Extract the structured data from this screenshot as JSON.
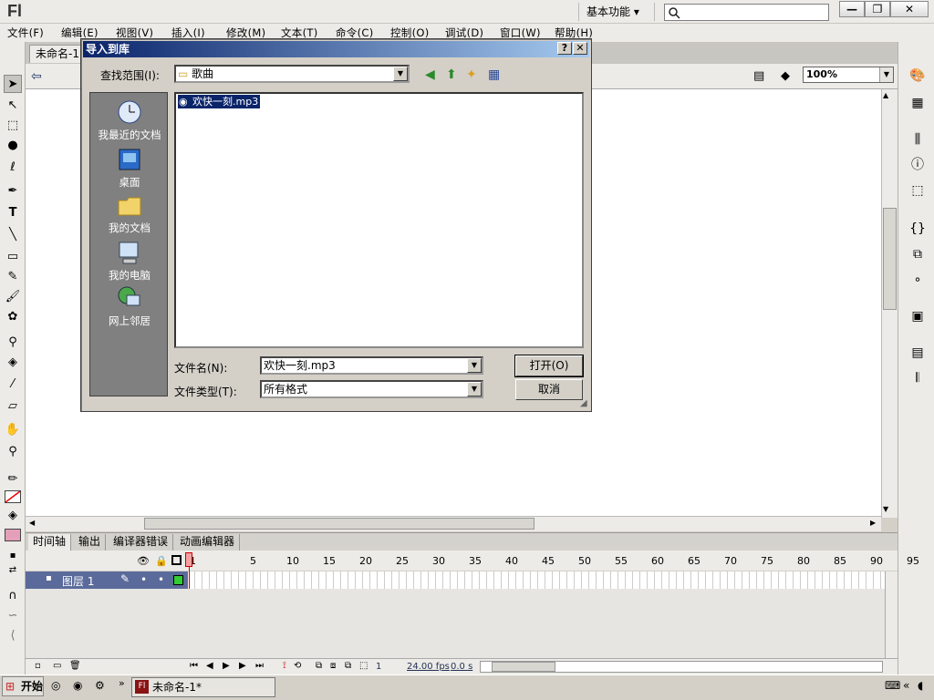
{
  "app": {
    "logo": "Fl",
    "workspace": "基本功能 ▾",
    "window_buttons": [
      "—",
      "❐",
      "✕"
    ]
  },
  "menu": [
    "文件(F)",
    "编辑(E)",
    "视图(V)",
    "插入(I)",
    "修改(M)",
    "文本(T)",
    "命令(C)",
    "控制(O)",
    "调试(D)",
    "窗口(W)",
    "帮助(H)"
  ],
  "document": {
    "tab": "未命名-1",
    "zoom": "100%"
  },
  "dialog": {
    "title": "导入到库",
    "look_in_label": "查找范围(I):",
    "look_in_value": "歌曲",
    "places": [
      "我最近的文档",
      "桌面",
      "我的文档",
      "我的电脑",
      "网上邻居"
    ],
    "files": [
      "欢快一刻.mp3"
    ],
    "filename_label": "文件名(N):",
    "filename_value": "欢快一刻.mp3",
    "filetype_label": "文件类型(T):",
    "filetype_value": "所有格式",
    "open_button": "打开(O)",
    "cancel_button": "取消",
    "help_button": "?",
    "close_button": "✕"
  },
  "timeline": {
    "tabs": [
      "时间轴",
      "输出",
      "编译器错误",
      "动画编辑器"
    ],
    "frame_numbers": [
      "1",
      "5",
      "10",
      "15",
      "20",
      "25",
      "30",
      "35",
      "40",
      "45",
      "50",
      "55",
      "60",
      "65",
      "70",
      "75",
      "80",
      "85",
      "90",
      "95"
    ],
    "layer_name": "图层 1",
    "status": {
      "frame": "1",
      "fps": "24.00 fps",
      "time": "0.0 s"
    }
  },
  "taskbar": {
    "start": "开始",
    "task": "未命名-1*"
  },
  "colors": {
    "title_start": "#0a246a",
    "title_end": "#a6caf0",
    "layer_row": "#5a6a9a",
    "playhead": "#cc0000"
  }
}
